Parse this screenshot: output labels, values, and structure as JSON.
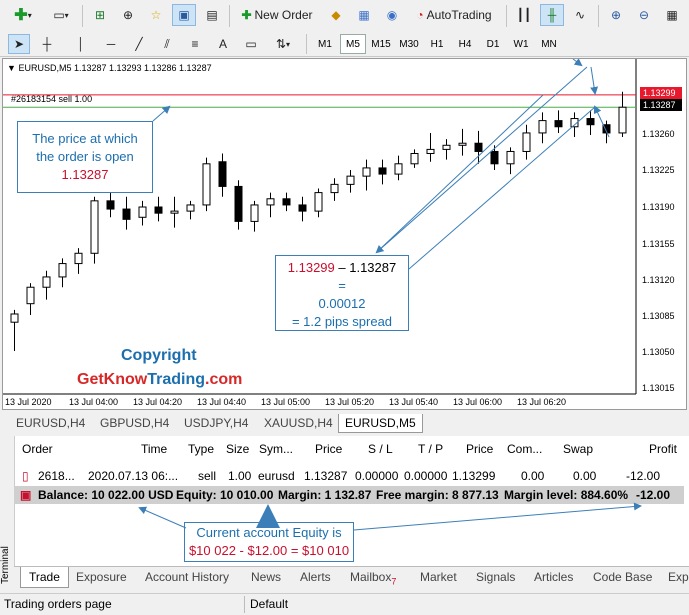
{
  "toolbar": {
    "new_order": "New Order",
    "autotrading": "AutoTrading",
    "timeframes": [
      "M1",
      "M5",
      "M15",
      "M30",
      "H1",
      "H4",
      "D1",
      "W1",
      "MN"
    ],
    "selected_timeframe": "M5"
  },
  "chart": {
    "title": "EURUSD,M5  1.13287 1.13293 1.13286 1.13287",
    "order_label": "#26183154 sell 1.00",
    "ask_tag": "1.13299",
    "bid_tag": "1.13287",
    "price_ticks": [
      "1.13260",
      "1.13225",
      "1.13190",
      "1.13155",
      "1.13120",
      "1.13085",
      "1.13050",
      "1.13015"
    ],
    "time_ticks": [
      "13 Jul 2020",
      "13 Jul 04:00",
      "13 Jul 04:20",
      "13 Jul 04:40",
      "13 Jul 05:00",
      "13 Jul 05:20",
      "13 Jul 05:40",
      "13 Jul 06:00",
      "13 Jul 06:20"
    ],
    "colors": {
      "ask_line": "#e8192c",
      "bid_line": "#4cae4c",
      "candle": "#000000"
    }
  },
  "annotations": {
    "open_price": {
      "line1": "The price at which",
      "line2": "the order is open",
      "value": "1.13287"
    },
    "spread": {
      "ask": "1.13299",
      "dash": " – ",
      "bid": "1.13287",
      "eq": "=",
      "diff": "0.00012",
      "pips": "= 1.2 pips spread"
    },
    "copyright": {
      "line1": "Copyright",
      "brand1": "GetKnow",
      "brand2": "Trading",
      "brand3": ".com"
    },
    "equity": {
      "line1": "Current account Equity is",
      "line2": "$10 022 - $12.00 = $10 010"
    }
  },
  "symbol_tabs": [
    "EURUSD,H4",
    "GBPUSD,H4",
    "USDJPY,H4",
    "XAUUSD,H4",
    "EURUSD,M5"
  ],
  "selected_symbol_tab": "EURUSD,M5",
  "terminal": {
    "side_label": "Terminal",
    "headers": [
      "Order",
      "Time",
      "Type",
      "Size",
      "Sym...",
      "Price",
      "S / L",
      "T / P",
      "Price",
      "Com...",
      "Swap",
      "Profit"
    ],
    "row": {
      "order": "2618...",
      "time": "2020.07.13 06:...",
      "type": "sell",
      "size": "1.00",
      "symbol": "eurusd",
      "price": "1.13287",
      "sl": "0.00000",
      "tp": "0.00000",
      "price2": "1.13299",
      "commission": "0.00",
      "swap": "0.00",
      "profit": "-12.00"
    },
    "balance": {
      "balance": "Balance: 10 022.00 USD",
      "equity": "Equity: 10 010.00",
      "margin": "Margin: 1 132.87",
      "free": "Free margin: 8 877.13",
      "level": "Margin level: 884.60%",
      "profit": "-12.00"
    },
    "tabs": [
      "Trade",
      "Exposure",
      "Account History",
      "News",
      "Alerts",
      "Mailbox",
      "Market",
      "Signals",
      "Articles",
      "Code Base",
      "Exp"
    ],
    "mailbox_count": "7",
    "selected_tab": "Trade"
  },
  "status": {
    "left": "Trading orders page",
    "right": "Default"
  }
}
